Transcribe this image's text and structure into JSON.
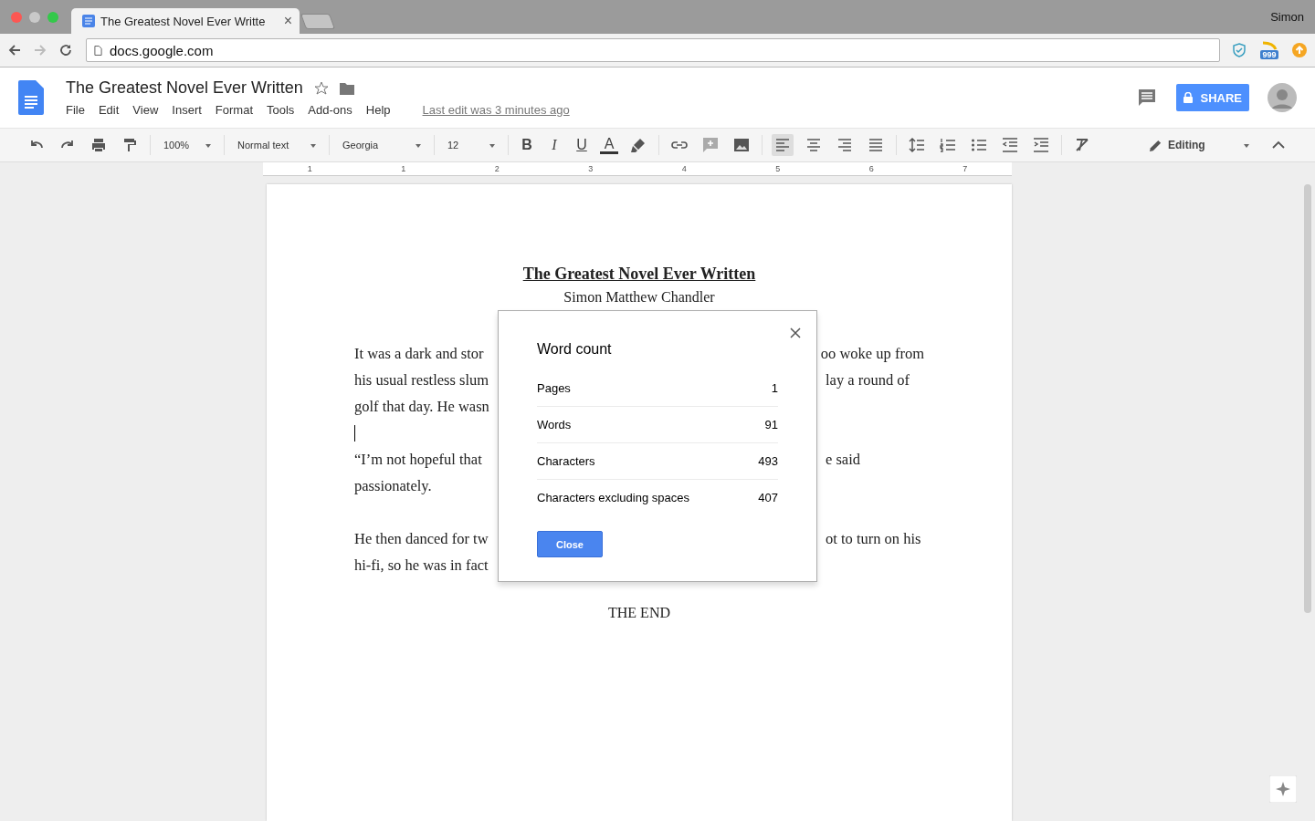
{
  "browser": {
    "tab": {
      "title": "The Greatest Novel Ever Writte",
      "close": "×"
    },
    "profile": "Simon",
    "url": "docs.google.com",
    "extension_badge": "999"
  },
  "docs": {
    "title": "The Greatest Novel Ever Written",
    "menu": [
      "File",
      "Edit",
      "View",
      "Insert",
      "Format",
      "Tools",
      "Add-ons",
      "Help"
    ],
    "last_edit": "Last edit was 3 minutes ago",
    "share": "SHARE"
  },
  "toolbar": {
    "zoom": "100%",
    "style": "Normal text",
    "font": "Georgia",
    "size": "12",
    "format": [
      {
        "kind": "bold",
        "label": "B"
      },
      {
        "kind": "italic",
        "label": "I"
      },
      {
        "kind": "underline",
        "label": "U"
      },
      {
        "kind": "color",
        "label": "A"
      }
    ],
    "alignment": [
      {
        "kind": "left",
        "selected": true
      },
      {
        "kind": "center",
        "selected": false
      },
      {
        "kind": "right",
        "selected": false
      },
      {
        "kind": "justify",
        "selected": false
      }
    ],
    "mode": "Editing"
  },
  "ruler": [
    "1",
    "1",
    "2",
    "3",
    "4",
    "5",
    "6",
    "7"
  ],
  "document": {
    "title": "The Greatest Novel Ever Written",
    "author": "Simon Matthew Chandler",
    "lines": [
      {
        "kind": "text",
        "left": "It was a dark and stor",
        "right": "oo woke up from"
      },
      {
        "kind": "text",
        "left": "his usual restless slum",
        "right": "lay a round of"
      },
      {
        "kind": "text",
        "left": "golf that day. He wasn"
      },
      {
        "kind": "cursor"
      },
      {
        "kind": "text",
        "left": "“I’m not hopeful that",
        "right": "e said"
      },
      {
        "kind": "text",
        "left": "passionately."
      },
      {
        "kind": "blank"
      },
      {
        "kind": "text",
        "left": "He then danced for tw",
        "right": "ot to turn on his"
      },
      {
        "kind": "text",
        "left": "hi-fi, so he was in fact"
      },
      {
        "kind": "blank"
      }
    ],
    "ending": "THE END"
  },
  "dialog": {
    "title": "Word count",
    "rows": [
      {
        "label": "Pages",
        "value": "1"
      },
      {
        "label": "Words",
        "value": "91"
      },
      {
        "label": "Characters",
        "value": "493"
      },
      {
        "label": "Characters excluding spaces",
        "value": "407"
      }
    ],
    "button": "Close"
  }
}
